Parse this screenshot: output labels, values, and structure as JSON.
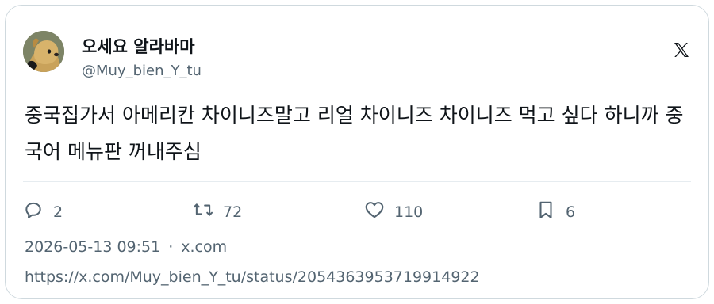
{
  "author": {
    "display_name": "오세요 알라바마",
    "handle": "@Muy_bien_Y_tu"
  },
  "tweet": {
    "text": "중국집가서 아메리칸 차이니즈말고 리얼 차이니즈 차이니즈 먹고 싶다 하니까 중국어 메뉴판 꺼내주심"
  },
  "actions": {
    "replies": "2",
    "retweets": "72",
    "likes": "110",
    "bookmarks": "6"
  },
  "meta": {
    "timestamp": "2026-05-13 09:51",
    "separator": "·",
    "source": "x.com"
  },
  "url": "https://x.com/Muy_bien_Y_tu/status/2054363953719914922",
  "icons": {
    "logo": "x-logo-icon",
    "reply": "reply-icon",
    "retweet": "retweet-icon",
    "like": "heart-icon",
    "bookmark": "bookmark-icon"
  }
}
